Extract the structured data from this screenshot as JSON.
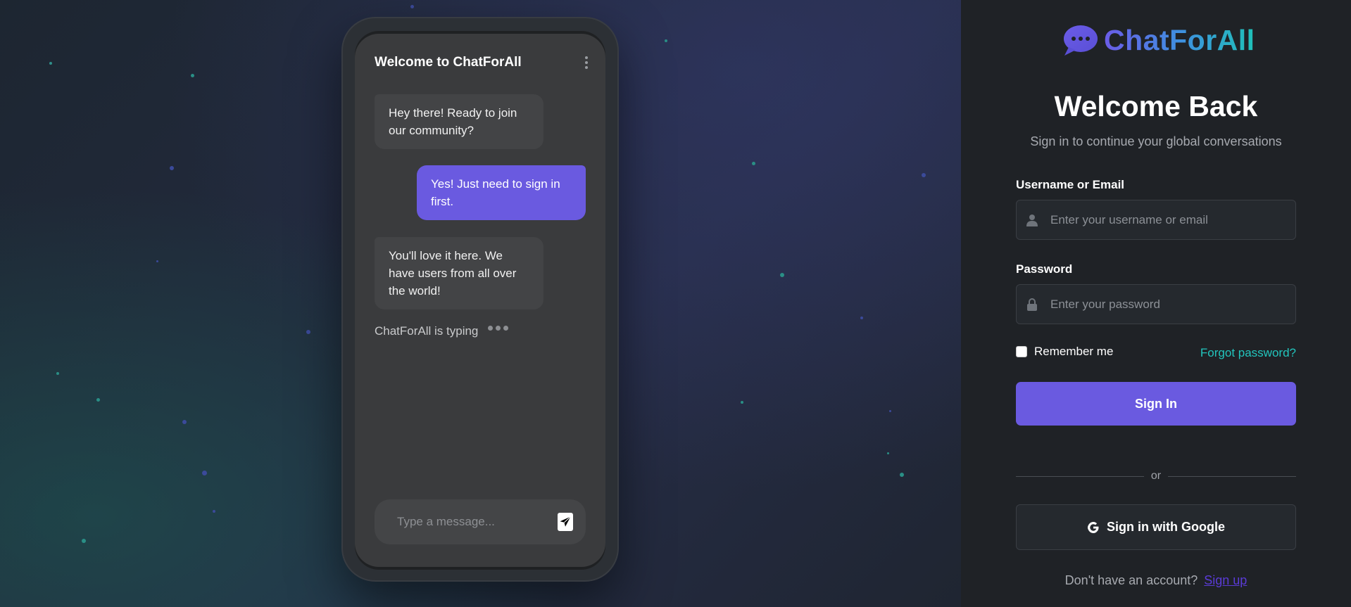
{
  "chat": {
    "title": "Welcome to ChatForAll",
    "messages": [
      {
        "from": "them",
        "text": "Hey there! Ready to join our community?"
      },
      {
        "from": "me",
        "text": "Yes! Just need to sign in first."
      },
      {
        "from": "them",
        "text": "You'll love it here. We have users from all over the world!"
      }
    ],
    "typing_text": "ChatForAll is typing",
    "composer_placeholder": "Type a message..."
  },
  "brand": {
    "name": "ChatForAll",
    "icon": "chat-bubble-icon"
  },
  "login": {
    "heading": "Welcome Back",
    "subtitle": "Sign in to continue your global conversations",
    "username_label": "Username or Email",
    "username_placeholder": "Enter your username or email",
    "password_label": "Password",
    "password_placeholder": "Enter your password",
    "remember_label": "Remember me",
    "forgot_label": "Forgot password?",
    "signin_label": "Sign In",
    "divider_text": "or",
    "google_label": "Sign in with Google",
    "no_account_text": "Don't have an account?",
    "signup_label": "Sign up"
  },
  "colors": {
    "accent": "#6a5ae0",
    "teal": "#22c5bd",
    "panel_bg": "#1f2226"
  }
}
